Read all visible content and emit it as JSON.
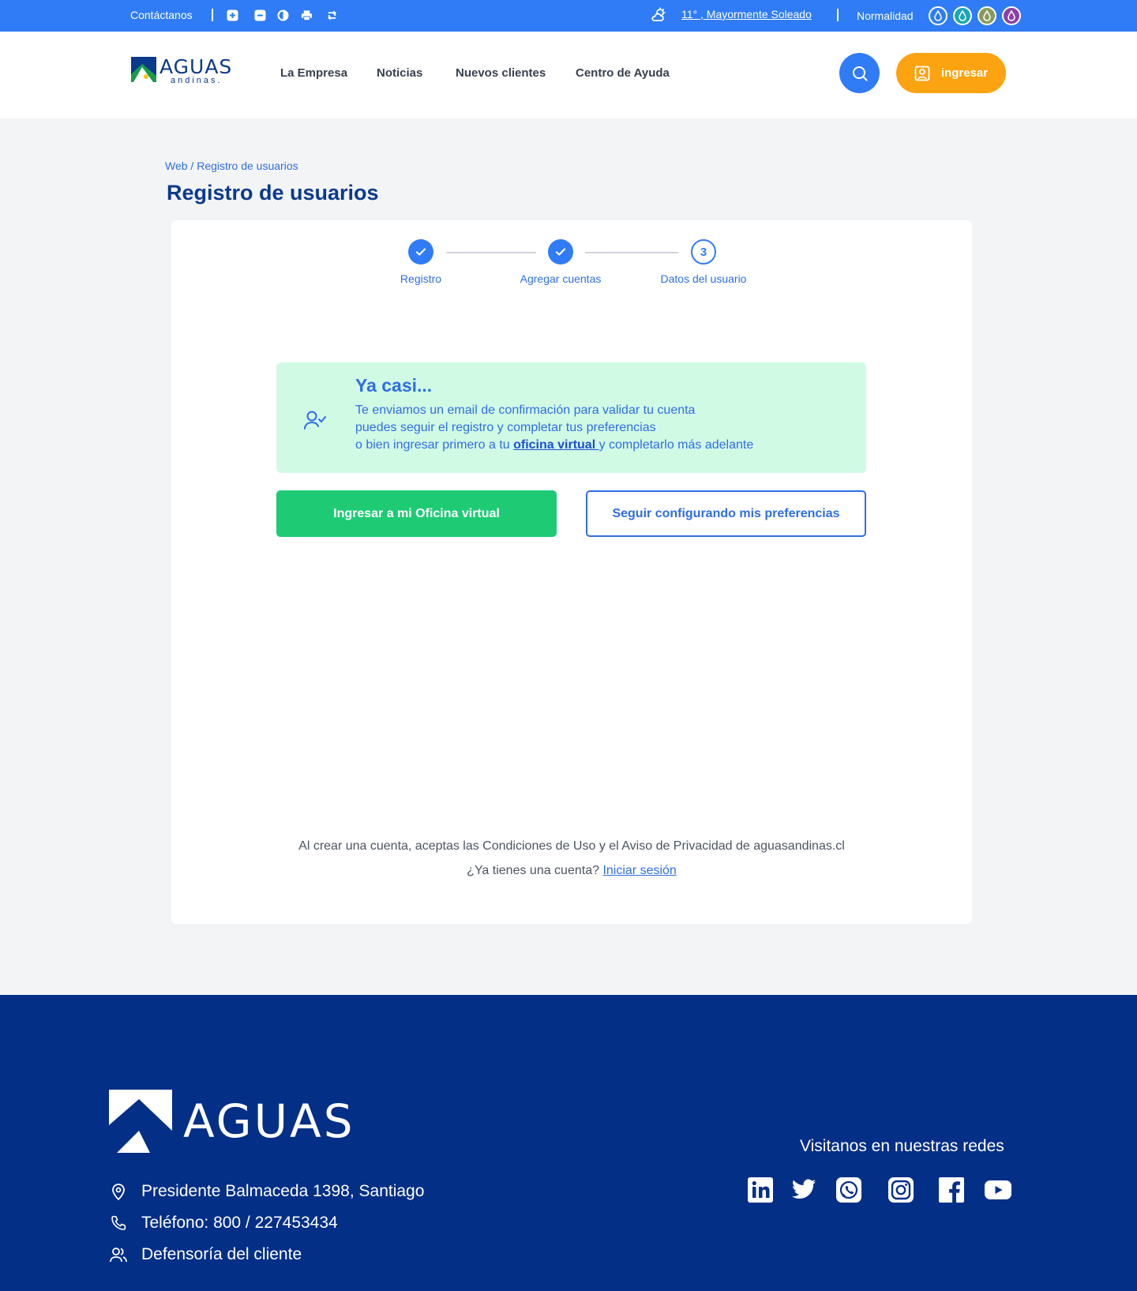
{
  "topbar": {
    "contact_label": "Contáctanos",
    "weather_text": "11° , Mayormente Soleado",
    "status_text": "Normalidad",
    "drop_colors": [
      "#2f7cf6",
      "#1aa7b5",
      "#8a9a5b",
      "#8b3fa8"
    ]
  },
  "header": {
    "logo_main": "AGUAS",
    "logo_sub": "andinas.",
    "nav": [
      "La Empresa",
      "Noticias",
      "Nuevos clientes",
      "Centro de Ayuda"
    ],
    "login_label": "ingresar"
  },
  "page": {
    "breadcrumb": "Web / Registro de usuarios",
    "title": "Registro de usuarios"
  },
  "steps": [
    {
      "label": "Registro",
      "status": "done"
    },
    {
      "label": "Agregar cuentas",
      "status": "done"
    },
    {
      "label": "Datos del usuario",
      "status": "current",
      "number": "3"
    }
  ],
  "notice": {
    "title": "Ya casi...",
    "line1": "Te enviamos un email de confirmación para validar tu cuenta",
    "line2": "puedes seguir el registro y completar tus preferencias",
    "line3_pre": "o bien ingresar primero a tu ",
    "line3_link": "oficina virtual ",
    "line3_post": "y completarlo más adelante"
  },
  "actions": {
    "primary": "Ingresar a mi Oficina virtual",
    "secondary": "Seguir configurando mis preferencias"
  },
  "legal": {
    "terms": "Al crear una cuenta, aceptas las Condiciones de Uso y el Aviso de Privacidad de aguasandinas.cl",
    "question": "¿Ya tienes una cuenta? ",
    "login_link": "Iniciar sesión"
  },
  "footer": {
    "logo_text": "AGUAS",
    "address": "Presidente Balmaceda 1398, Santiago",
    "phone": "Teléfono: 800 / 227453434",
    "defensoria": "Defensoría del cliente",
    "social_title": "Visitanos en nuestras redes",
    "social_icons": [
      "linkedin-icon",
      "twitter-icon",
      "whatsapp-icon",
      "instagram-icon",
      "facebook-icon",
      "youtube-icon"
    ]
  }
}
